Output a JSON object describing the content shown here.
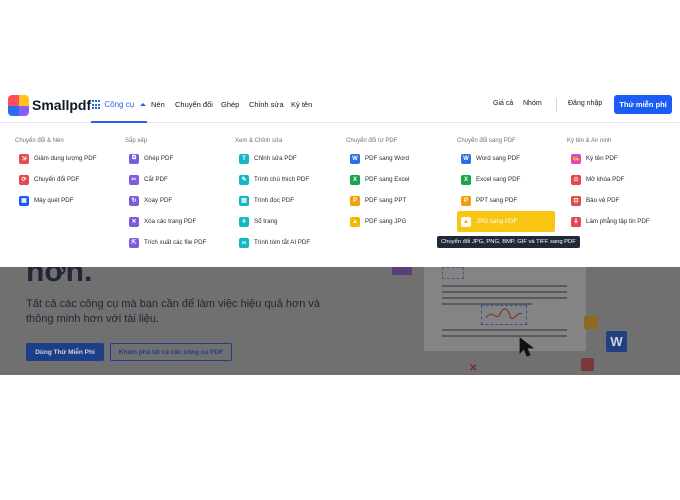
{
  "header": {
    "brand": "Smallpdf",
    "tools_label": "Công cụ",
    "nav": [
      "Nén",
      "Chuyển đổi",
      "Ghép",
      "Chỉnh sửa",
      "Ký tên"
    ],
    "pricing": "Giá cả",
    "team": "Nhóm",
    "login": "Đăng nhập",
    "free_trial": "Thử miễn phí"
  },
  "menu": {
    "columns": [
      {
        "title": "Chuyển đổi & Nén",
        "items": [
          {
            "label": "Giảm dung lượng PDF",
            "icon": "compress-icon",
            "color": "#e5484d"
          },
          {
            "label": "Chuyển đổi PDF",
            "icon": "convert-icon",
            "color": "#e5484d"
          },
          {
            "label": "Máy quét PDF",
            "icon": "scanner-icon",
            "color": "#1b5cf4"
          }
        ]
      },
      {
        "title": "Sắp xếp",
        "items": [
          {
            "label": "Ghép PDF",
            "icon": "merge-icon",
            "color": "#7c5cdb"
          },
          {
            "label": "Cắt PDF",
            "icon": "split-icon",
            "color": "#7c5cdb"
          },
          {
            "label": "Xoay PDF",
            "icon": "rotate-icon",
            "color": "#7c5cdb"
          },
          {
            "label": "Xóa các trang PDF",
            "icon": "delete-pages-icon",
            "color": "#7c5cdb"
          },
          {
            "label": "Trích xuất các file PDF",
            "icon": "extract-icon",
            "color": "#7c5cdb"
          }
        ]
      },
      {
        "title": "Xem & Chỉnh sửa",
        "items": [
          {
            "label": "Chỉnh sửa PDF",
            "icon": "edit-icon",
            "color": "#14b8c4"
          },
          {
            "label": "Trình chú thích PDF",
            "icon": "annotate-icon",
            "color": "#14b8c4"
          },
          {
            "label": "Trình đọc PDF",
            "icon": "reader-icon",
            "color": "#14b8c4"
          },
          {
            "label": "Số trang",
            "icon": "page-number-icon",
            "color": "#14b8c4"
          },
          {
            "label": "Trình tóm tắt AI PDF",
            "icon": "ai-icon",
            "color": "#14b8c4"
          }
        ]
      },
      {
        "title": "Chuyển đổi từ PDF",
        "items": [
          {
            "label": "PDF sang Word",
            "icon": "word-icon",
            "color": "#2b6fe0"
          },
          {
            "label": "PDF sang Excel",
            "icon": "excel-icon",
            "color": "#19a34a"
          },
          {
            "label": "PDF sang PPT",
            "icon": "ppt-icon",
            "color": "#f59e0b"
          },
          {
            "label": "PDF sang JPG",
            "icon": "jpg-icon",
            "color": "#f5b800"
          }
        ]
      },
      {
        "title": "Chuyển đổi sang PDF",
        "items": [
          {
            "label": "Word sang PDF",
            "icon": "word-icon",
            "color": "#2b6fe0"
          },
          {
            "label": "Excel sang PDF",
            "icon": "excel-icon",
            "color": "#19a34a"
          },
          {
            "label": "PPT sang PDF",
            "icon": "ppt-icon",
            "color": "#f59e0b"
          },
          {
            "label": "JPG sang PDF",
            "icon": "jpg-icon",
            "color": "#f5b800",
            "highlighted": true
          }
        ]
      },
      {
        "title": "Ký tên & An ninh",
        "items": [
          {
            "label": "Ký tên PDF",
            "icon": "sign-icon",
            "color": "#e43fc8"
          },
          {
            "label": "Mở khóa PDF",
            "icon": "unlock-icon",
            "color": "#e5484d"
          },
          {
            "label": "Bảo vệ PDF",
            "icon": "protect-icon",
            "color": "#e5484d"
          },
          {
            "label": "Làm phẳng tập tin PDF",
            "icon": "flatten-icon",
            "color": "#e5484d"
          }
        ]
      }
    ],
    "tooltip": "Chuyển đổi JPG, PNG, BMP, GIF và TIFF sang PDF"
  },
  "hero": {
    "title": "hơn.",
    "subtitle": "Tất cả các công cụ mà bạn cần để làm việc hiệu quả hơn và thông minh hơn với tài liệu.",
    "try_button": "Dùng Thử Miễn Phí",
    "explore_button": "Khám phá tất cả các công cụ PDF",
    "word_badge": "W"
  }
}
